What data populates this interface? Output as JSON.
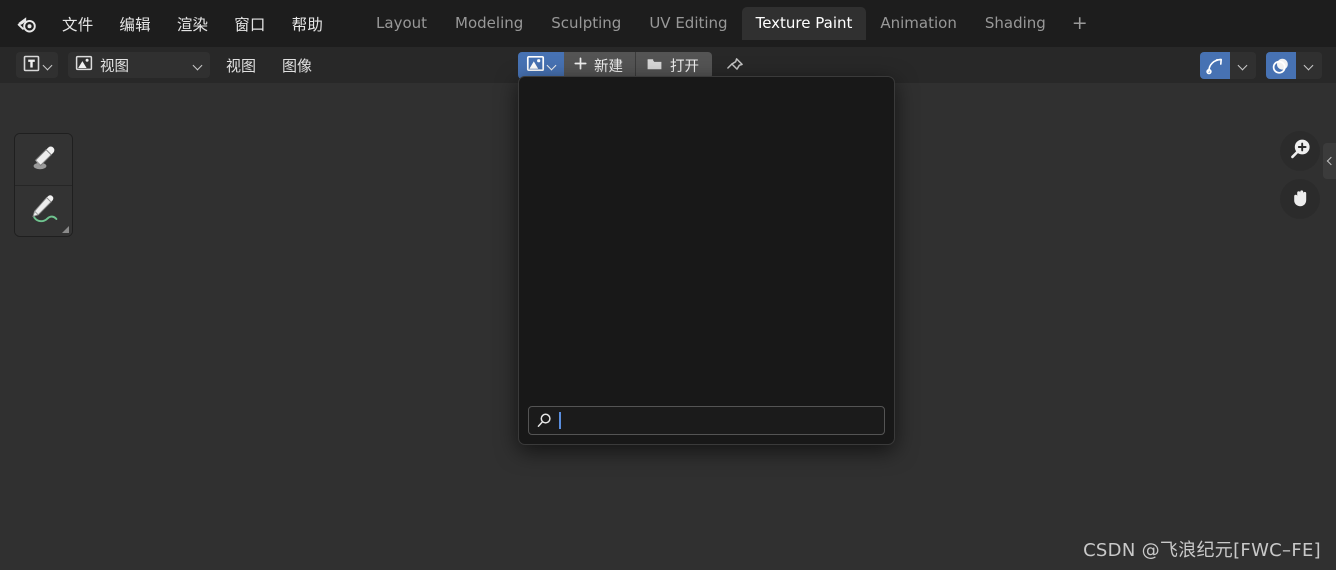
{
  "topbar": {
    "logo_icon": "blender-logo-icon",
    "menus": [
      {
        "label": "文件"
      },
      {
        "label": "编辑"
      },
      {
        "label": "渲染"
      },
      {
        "label": "窗口"
      },
      {
        "label": "帮助"
      }
    ],
    "workspace_tabs": [
      {
        "label": "Layout",
        "active": false
      },
      {
        "label": "Modeling",
        "active": false
      },
      {
        "label": "Sculpting",
        "active": false
      },
      {
        "label": "UV Editing",
        "active": false
      },
      {
        "label": "Texture Paint",
        "active": true
      },
      {
        "label": "Animation",
        "active": false
      },
      {
        "label": "Shading",
        "active": false
      }
    ],
    "add_workspace_label": "+"
  },
  "editor_header": {
    "editor_type_icon": "uv-image-editor-icon",
    "editor_type_chevron_icon": "chevron-down-icon",
    "mode_icon": "image-icon",
    "mode_label": "视图",
    "mode_chevron_icon": "chevron-down-icon",
    "menus": [
      {
        "label": "视图"
      },
      {
        "label": "图像"
      }
    ],
    "datablock": {
      "browse_icon": "image-browse-icon",
      "browse_chevron_icon": "chevron-down-icon",
      "new_icon": "plus-icon",
      "new_label": "新建",
      "open_icon": "folder-icon",
      "open_label": "打开",
      "pin_icon": "pin-icon"
    },
    "right_toggles": [
      {
        "name": "gizmos-toggle",
        "icon": "gizmo-curve-icon",
        "chevron_icon": "chevron-down-icon",
        "active": true
      },
      {
        "name": "overlays-toggle",
        "icon": "overlays-sphere-icon",
        "chevron_icon": "chevron-down-icon",
        "active": true
      }
    ]
  },
  "toolbar": {
    "tools": [
      {
        "name": "sample-tool",
        "icon": "eyedropper-icon",
        "has_subgroup": false
      },
      {
        "name": "annotate-tool",
        "icon": "annotate-pencil-icon",
        "has_subgroup": true
      }
    ]
  },
  "gizmos": [
    {
      "name": "zoom-gizmo",
      "icon": "magnifier-plus-icon"
    },
    {
      "name": "pan-gizmo",
      "icon": "hand-icon"
    }
  ],
  "sidebar_toggle": {
    "icon": "chevron-left-icon"
  },
  "popup": {
    "name": "image-datablock-browser",
    "items": [],
    "search": {
      "icon": "search-icon",
      "value": "",
      "placeholder": ""
    }
  },
  "watermark": {
    "text": "CSDN @飞浪纪元[FWC–FE]"
  },
  "colors": {
    "accent_blue": "#4772b3",
    "topbar_bg": "#1d1d1d",
    "header_bg": "#282828",
    "canvas_bg": "#303030",
    "popup_bg": "#181818",
    "caret_blue": "#5a8ede",
    "annotate_green": "#6fc48f"
  }
}
